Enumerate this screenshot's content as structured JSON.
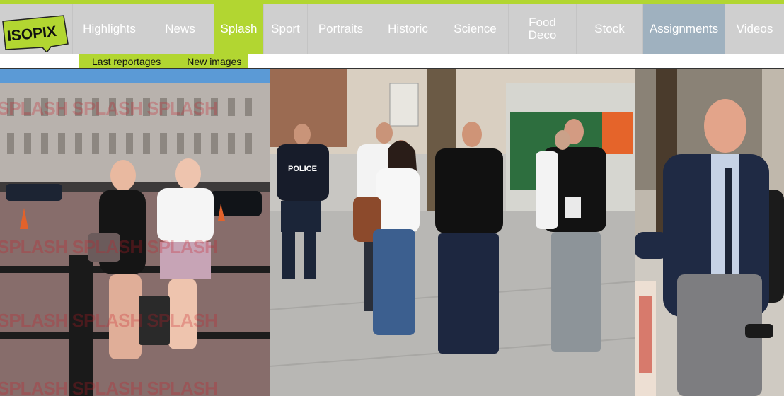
{
  "logo": {
    "text": "ISOPIX",
    "brand_color": "#b2d631"
  },
  "nav": {
    "highlights": "Highlights",
    "news": "News",
    "splash": "Splash",
    "sport": "Sport",
    "portraits": "Portraits",
    "historic": "Historic",
    "science": "Science",
    "food_deco": "Food Deco",
    "stock": "Stock",
    "assignments": "Assignments",
    "videos": "Videos",
    "active": "Splash"
  },
  "subnav": {
    "last_reportages": "Last reportages",
    "new_images": "New images"
  },
  "colors": {
    "accent": "#b2d631",
    "nav_bg": "#cfcfcf",
    "assignments_bg": "#9fb1bf",
    "watermark": "#c81e28"
  },
  "photos": {
    "photo1": {
      "watermark": "SPLASH SPLASH SPLASH",
      "police_text": ""
    },
    "photo2": {
      "police_text": "POLICE"
    },
    "photo3": {
      "watermark": ""
    }
  }
}
